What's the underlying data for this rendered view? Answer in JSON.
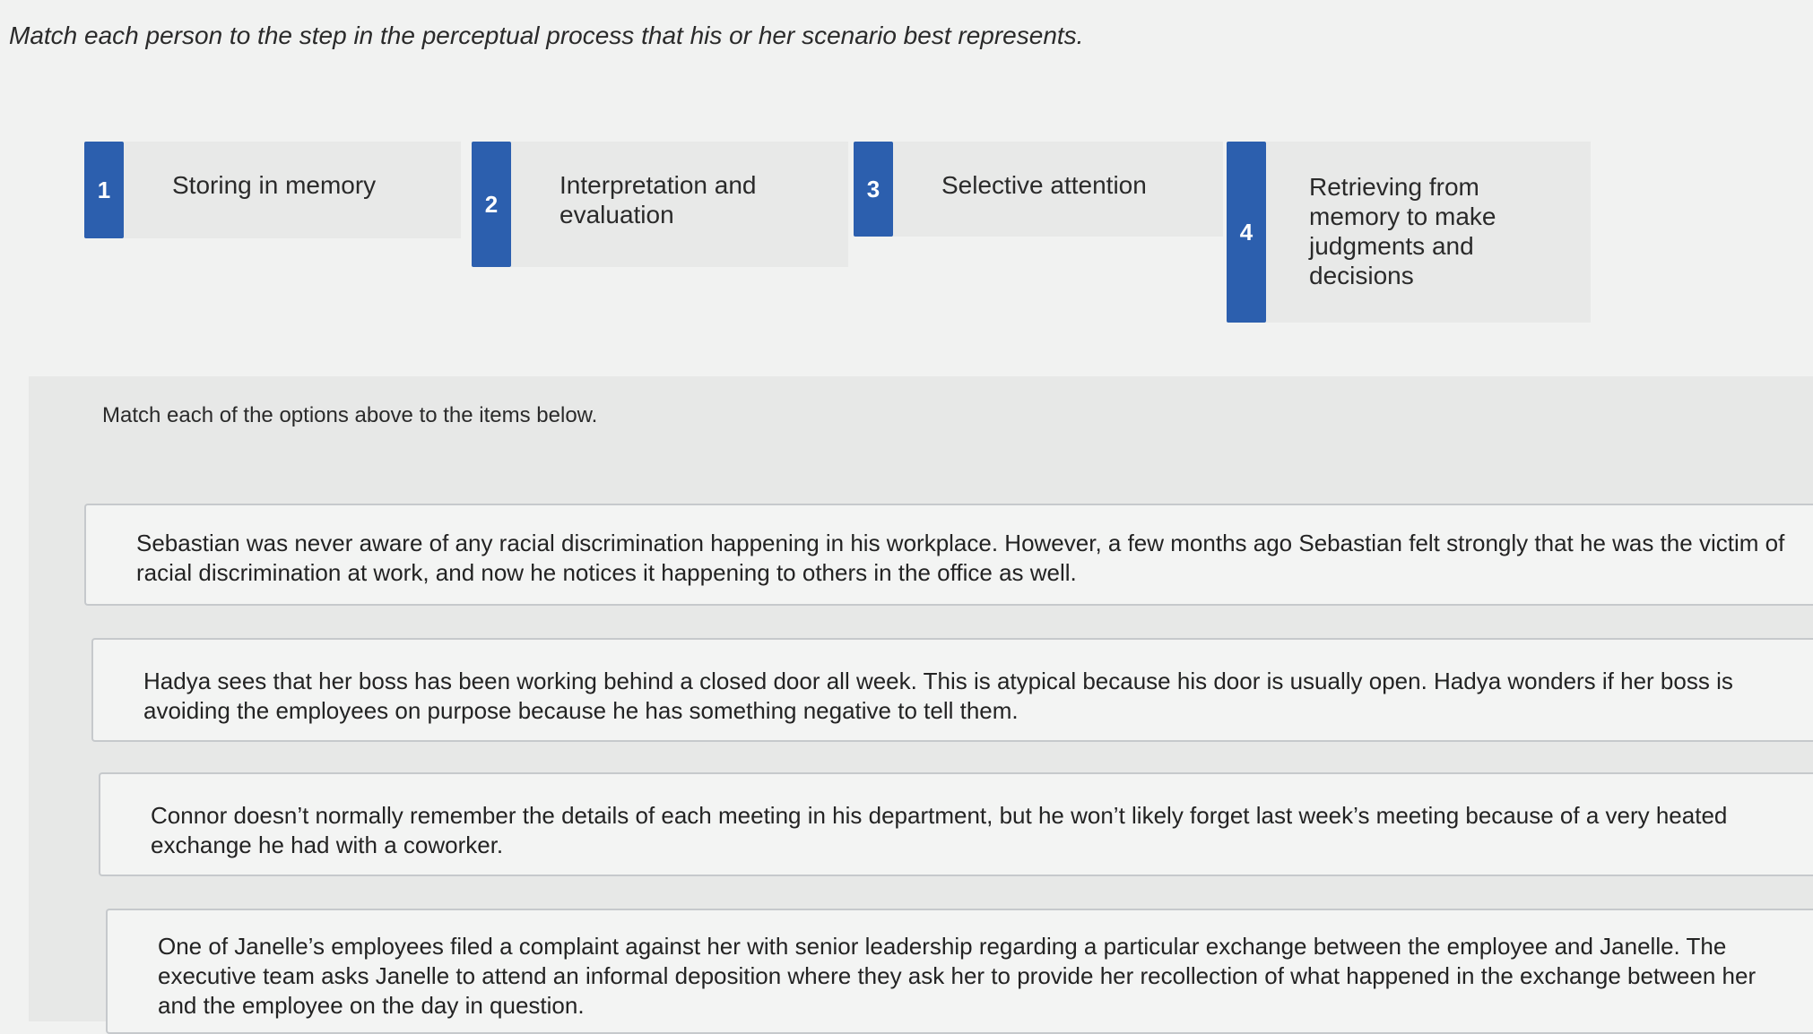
{
  "instruction": "Match each person to the step in the perceptual process that his or her scenario best represents.",
  "options": [
    {
      "number": "1",
      "label": "Storing in memory"
    },
    {
      "number": "2",
      "label": "Interpretation and evaluation"
    },
    {
      "number": "3",
      "label": "Selective attention"
    },
    {
      "number": "4",
      "label": "Retrieving from memory to make judgments and decisions"
    }
  ],
  "match_instruction": "Match each of the options above to the items below.",
  "items": [
    {
      "text": "Sebastian was never aware of any racial discrimination happening in his workplace. However, a few months ago Sebastian felt strongly that he was the victim of racial discrimination at work, and now he notices it happening to others in the office as well."
    },
    {
      "text": "Hadya sees that her boss has been working behind a closed door all week. This is atypical because his door is usually open. Hadya wonders if her boss is avoiding the employees on purpose because he has something negative to tell them."
    },
    {
      "text": "Connor doesn’t normally remember the details of each meeting in his department, but he won’t likely forget last week’s meeting because of a very heated exchange he had with a coworker."
    },
    {
      "text": "One of Janelle’s employees filed a complaint against her with senior leadership regarding a particular exchange between the employee and Janelle. The executive team asks Janelle to attend an informal deposition where they ask her to provide her recollection of what happened in the exchange between her and the employee on the day in question."
    }
  ]
}
